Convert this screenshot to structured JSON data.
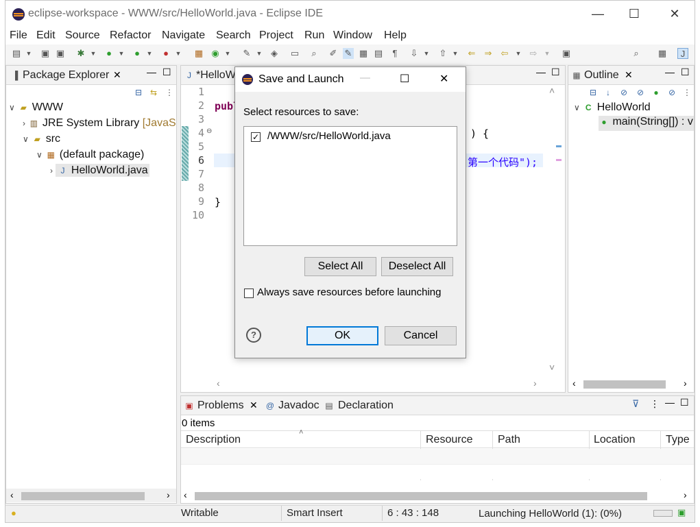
{
  "window": {
    "title": "eclipse-workspace - WWW/src/HelloWorld.java - Eclipse IDE",
    "minimize": "—",
    "maximize": "☐",
    "close": "✕"
  },
  "menu": [
    "File",
    "Edit",
    "Source",
    "Refactor",
    "Navigate",
    "Search",
    "Project",
    "Run",
    "Window",
    "Help"
  ],
  "package_explorer": {
    "tab_label": "Package Explorer",
    "tree": {
      "project": "WWW",
      "jre": "JRE System Library",
      "jre_suffix": "[JavaS",
      "src": "src",
      "package": "(default package)",
      "file": "HelloWorld.java"
    }
  },
  "editor": {
    "tab_label": "*HelloW",
    "lines": [
      "1",
      "2",
      "3",
      "4",
      "5",
      "6",
      "7",
      "8",
      "9",
      "10"
    ],
    "code": {
      "line2": "publ",
      "line4_tail": ") {",
      "line6_tail": "第一个代码\");",
      "line9": "}"
    }
  },
  "outline": {
    "tab_label": "Outline",
    "class_name": "HelloWorld",
    "method": "main(String[]) : v"
  },
  "dialog": {
    "title": "Save and Launch",
    "prompt": "Select resources to save:",
    "resource": "/WWW/src/HelloWorld.java",
    "resource_checked": "✓",
    "select_all": "Select All",
    "deselect_all": "Deselect All",
    "always_save": "Always save resources before launching",
    "help": "?",
    "ok": "OK",
    "cancel": "Cancel",
    "minimize": "—",
    "maximize": "☐",
    "close": "✕"
  },
  "bottom_panel": {
    "tabs": [
      "Problems",
      "Javadoc",
      "Declaration"
    ],
    "count": "0 items",
    "columns": [
      "Description",
      "Resource",
      "Path",
      "Location",
      "Type"
    ]
  },
  "status_bar": {
    "writable": "Writable",
    "insert_mode": "Smart Insert",
    "position": "6 : 43 : 148",
    "progress": "Launching HelloWorld (1): (0%)"
  },
  "colors": {
    "accent": "#0078d7",
    "selection": "#e6e6e6",
    "keyword": "#7f0055"
  }
}
